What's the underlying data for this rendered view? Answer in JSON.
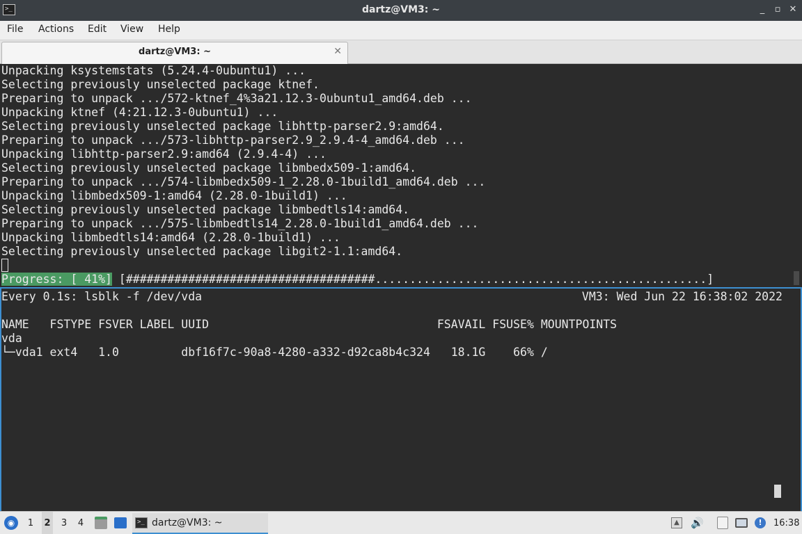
{
  "window": {
    "title": "dartz@VM3: ~",
    "minimize_label": "_",
    "restore_label": "▫",
    "close_label": "✕"
  },
  "menu": {
    "file": "File",
    "actions": "Actions",
    "edit": "Edit",
    "view": "View",
    "help": "Help"
  },
  "tab": {
    "label": "dartz@VM3: ~",
    "close_label": "✕"
  },
  "top_pane": {
    "lines": [
      "Unpacking ksystemstats (5.24.4-0ubuntu1) ...",
      "Selecting previously unselected package ktnef.",
      "Preparing to unpack .../572-ktnef_4%3a21.12.3-0ubuntu1_amd64.deb ...",
      "Unpacking ktnef (4:21.12.3-0ubuntu1) ...",
      "Selecting previously unselected package libhttp-parser2.9:amd64.",
      "Preparing to unpack .../573-libhttp-parser2.9_2.9.4-4_amd64.deb ...",
      "Unpacking libhttp-parser2.9:amd64 (2.9.4-4) ...",
      "Selecting previously unselected package libmbedx509-1:amd64.",
      "Preparing to unpack .../574-libmbedx509-1_2.28.0-1build1_amd64.deb ...",
      "Unpacking libmbedx509-1:amd64 (2.28.0-1build1) ...",
      "Selecting previously unselected package libmbedtls14:amd64.",
      "Preparing to unpack .../575-libmbedtls14_2.28.0-1build1_amd64.deb ...",
      "Unpacking libmbedtls14:amd64 (2.28.0-1build1) ...",
      "Selecting previously unselected package libgit2-1.1:amd64."
    ],
    "progress_label": "Progress: [ 41%]",
    "progress_bar": " [####################################................................................]",
    "progress_fraction": 0.41
  },
  "bottom_pane": {
    "command": "Every 0.1s: lsblk -f /dev/vda",
    "host_time": "VM3: Wed Jun 22 16:38:02 2022",
    "table_header": "NAME   FSTYPE FSVER LABEL UUID                                 FSAVAIL FSUSE% MOUNTPOINTS",
    "rows": [
      "vda",
      "└─vda1 ext4   1.0         dbf16f7c-90a8-4280-a332-d92ca8b4c324   18.1G    66% /"
    ]
  },
  "taskbar": {
    "desktops": [
      "1",
      "2",
      "3",
      "4"
    ],
    "active_desktop": "2",
    "task_label": "dartz@VM3: ~",
    "clock": "16:38"
  },
  "colors": {
    "terminal_bg": "#2b2b2b",
    "terminal_fg": "#e8e8e8",
    "progress_bg": "#4a9a62",
    "focus_border": "#3d8fd1"
  }
}
